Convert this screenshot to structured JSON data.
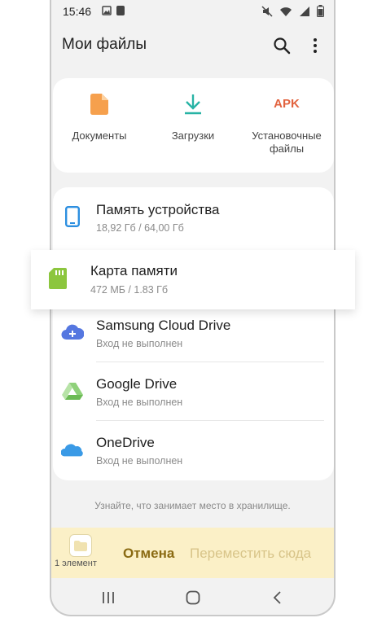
{
  "status": {
    "time": "15:46"
  },
  "appbar": {
    "title": "Мои файлы"
  },
  "categories": [
    {
      "label": "Документы",
      "icon": "document-icon"
    },
    {
      "label": "Загрузки",
      "icon": "download-icon"
    },
    {
      "label": "Установочные файлы",
      "icon": "apk-icon",
      "icon_text": "APK"
    }
  ],
  "storage": [
    {
      "name": "Память устройства",
      "sub": "18,92 Гб / 64,00 Гб",
      "icon": "phone-icon"
    },
    {
      "name": "Samsung Cloud Drive",
      "sub": "Вход не выполнен",
      "icon": "samsung-cloud-icon"
    },
    {
      "name": "Google Drive",
      "sub": "Вход не выполнен",
      "icon": "google-drive-icon"
    },
    {
      "name": "OneDrive",
      "sub": "Вход не выполнен",
      "icon": "onedrive-icon"
    }
  ],
  "highlight": {
    "name": "Карта памяти",
    "sub": "472 МБ / 1.83 Гб",
    "icon": "sd-card-icon"
  },
  "hint": "Узнайте, что занимает место в хранилище.",
  "bottombar": {
    "count": "1 элемент",
    "cancel": "Отмена",
    "move": "Переместить сюда"
  },
  "colors": {
    "accent_orange": "#f6a04d",
    "accent_teal": "#27b3a5",
    "apk_red": "#e2633f",
    "sd_green": "#8cc63e",
    "bar_bg": "#fbf0c7"
  }
}
